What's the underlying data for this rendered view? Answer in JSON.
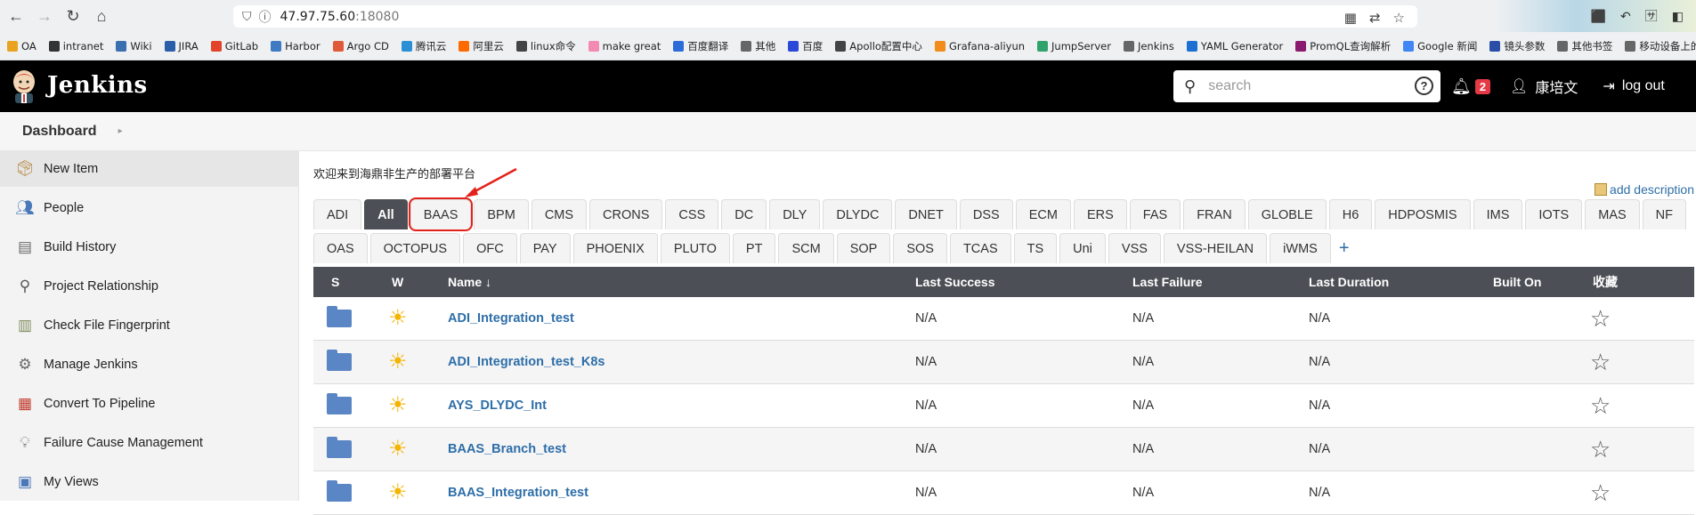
{
  "browser": {
    "url_host": "47.97.75.60",
    "url_port": ":18080"
  },
  "bookmarks": [
    {
      "label": "OA",
      "color": "#e9a320"
    },
    {
      "label": "intranet",
      "color": "#333333"
    },
    {
      "label": "Wiki",
      "color": "#3a6fb0"
    },
    {
      "label": "JIRA",
      "color": "#2a5ea8"
    },
    {
      "label": "GitLab",
      "color": "#e24329"
    },
    {
      "label": "Harbor",
      "color": "#3e7bc2"
    },
    {
      "label": "Argo CD",
      "color": "#e05a3a"
    },
    {
      "label": "腾讯云",
      "color": "#2b8fd6"
    },
    {
      "label": "阿里云",
      "color": "#ff6a00"
    },
    {
      "label": "linux命令",
      "color": "#444444"
    },
    {
      "label": "make great",
      "color": "#f28ab2"
    },
    {
      "label": "百度翻译",
      "color": "#2b6cd9"
    },
    {
      "label": "其他",
      "color": "#666666"
    },
    {
      "label": "百度",
      "color": "#2b48d9"
    },
    {
      "label": "Apollo配置中心",
      "color": "#444444"
    },
    {
      "label": "Grafana-aliyun",
      "color": "#f28c1b"
    },
    {
      "label": "JumpServer",
      "color": "#2fa36b"
    },
    {
      "label": "Jenkins",
      "color": "#666666"
    },
    {
      "label": "YAML Generator",
      "color": "#1d6fd1"
    },
    {
      "label": "PromQL查询解析",
      "color": "#8a1a6e"
    },
    {
      "label": "Google 新闻",
      "color": "#4285f4"
    },
    {
      "label": "镜头参数",
      "color": "#2a4ea8"
    },
    {
      "label": "其他书签",
      "color": "#666666"
    },
    {
      "label": "移动设备上的书签",
      "color": "#666666"
    }
  ],
  "header": {
    "brand": "Jenkins",
    "search_placeholder": "search",
    "notifications": "2",
    "user": "康培文",
    "logout": "log out"
  },
  "breadcrumb": {
    "dashboard": "Dashboard"
  },
  "sidebar": {
    "items": [
      {
        "label": "New Item",
        "icon": "package-icon"
      },
      {
        "label": "People",
        "icon": "people-icon"
      },
      {
        "label": "Build History",
        "icon": "notepad-icon"
      },
      {
        "label": "Project Relationship",
        "icon": "magnifier-icon"
      },
      {
        "label": "Check File Fingerprint",
        "icon": "fingerprint-icon"
      },
      {
        "label": "Manage Jenkins",
        "icon": "gear-icon"
      },
      {
        "label": "Convert To Pipeline",
        "icon": "document-icon"
      },
      {
        "label": "Failure Cause Management",
        "icon": "lightbulb-icon"
      },
      {
        "label": "My Views",
        "icon": "views-icon"
      }
    ]
  },
  "main": {
    "welcome": "欢迎来到海鼎非生产的部署平台",
    "add_description": "add description",
    "tabs_row1": [
      "ADI",
      "All",
      "BAAS",
      "BPM",
      "CMS",
      "CRONS",
      "CSS",
      "DC",
      "DLY",
      "DLYDC",
      "DNET",
      "DSS",
      "ECM",
      "ERS",
      "FAS",
      "FRAN",
      "GLOBLE",
      "H6",
      "HDPOSMIS",
      "IMS",
      "IOTS",
      "MAS",
      "NF"
    ],
    "tabs_row2": [
      "OAS",
      "OCTOPUS",
      "OFC",
      "PAY",
      "PHOENIX",
      "PLUTO",
      "PT",
      "SCM",
      "SOP",
      "SOS",
      "TCAS",
      "TS",
      "Uni",
      "VSS",
      "VSS-HEILAN",
      "iWMS"
    ],
    "active_tab": "All",
    "highlighted_tab": "BAAS",
    "plus": "+"
  },
  "table": {
    "headers": {
      "s": "S",
      "w": "W",
      "name": "Name ↓",
      "last_success": "Last Success",
      "last_failure": "Last Failure",
      "last_duration": "Last Duration",
      "built_on": "Built On",
      "favorite": "收藏"
    },
    "rows": [
      {
        "name": "ADI_Integration_test",
        "last_success": "N/A",
        "last_failure": "N/A",
        "last_duration": "N/A"
      },
      {
        "name": "ADI_Integration_test_K8s",
        "last_success": "N/A",
        "last_failure": "N/A",
        "last_duration": "N/A"
      },
      {
        "name": "AYS_DLYDC_Int",
        "last_success": "N/A",
        "last_failure": "N/A",
        "last_duration": "N/A"
      },
      {
        "name": "BAAS_Branch_test",
        "last_success": "N/A",
        "last_failure": "N/A",
        "last_duration": "N/A"
      },
      {
        "name": "BAAS_Integration_test",
        "last_success": "N/A",
        "last_failure": "N/A",
        "last_duration": "N/A"
      }
    ]
  },
  "colors": {
    "accent_link": "#2d6ea8",
    "highlight": "#e3221a",
    "header_bg": "#000000",
    "table_header_bg": "#4c4f55",
    "badge": "#e63946"
  }
}
